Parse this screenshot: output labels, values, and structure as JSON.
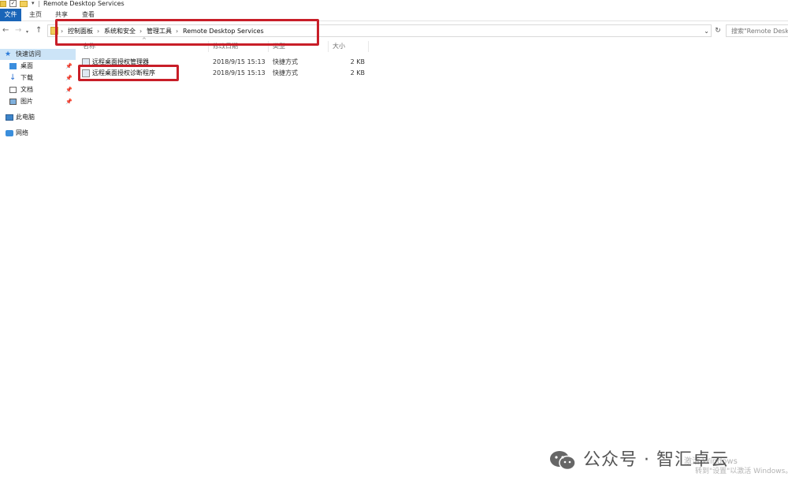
{
  "window": {
    "title": "Remote Desktop Services"
  },
  "ribbon": {
    "tabs": [
      {
        "label": "文件"
      },
      {
        "label": "主页"
      },
      {
        "label": "共享"
      },
      {
        "label": "查看"
      }
    ]
  },
  "address": {
    "crumbs": [
      "控制面板",
      "系统和安全",
      "管理工具",
      "Remote Desktop Services"
    ]
  },
  "search": {
    "placeholder": "搜索\"Remote Deskto"
  },
  "nav": {
    "items": [
      {
        "label": "快速访问",
        "icon": "star-icon"
      },
      {
        "label": "桌面",
        "icon": "desktop-icon",
        "pinned": true
      },
      {
        "label": "下载",
        "icon": "download-icon",
        "pinned": true
      },
      {
        "label": "文档",
        "icon": "document-icon",
        "pinned": true
      },
      {
        "label": "图片",
        "icon": "picture-icon",
        "pinned": true
      },
      {
        "label": "此电脑",
        "icon": "computer-icon"
      },
      {
        "label": "网络",
        "icon": "network-icon"
      }
    ]
  },
  "columns": {
    "name": "名称",
    "date": "修改日期",
    "type": "类型",
    "size": "大小"
  },
  "files": [
    {
      "name": "远程桌面授权管理器",
      "date": "2018/9/15 15:13",
      "type": "快捷方式",
      "size": "2 KB"
    },
    {
      "name": "远程桌面授权诊断程序",
      "date": "2018/9/15 15:13",
      "type": "快捷方式",
      "size": "2 KB"
    }
  ],
  "watermark": {
    "text": "公众号 · 智汇卓云"
  },
  "activation": {
    "line1": "激活 Windows",
    "line2": "转到\"设置\"以激活 Windows。"
  },
  "colors": {
    "accent": "#1a65b8",
    "highlight": "#c81e28",
    "selection": "#cce4f7"
  }
}
